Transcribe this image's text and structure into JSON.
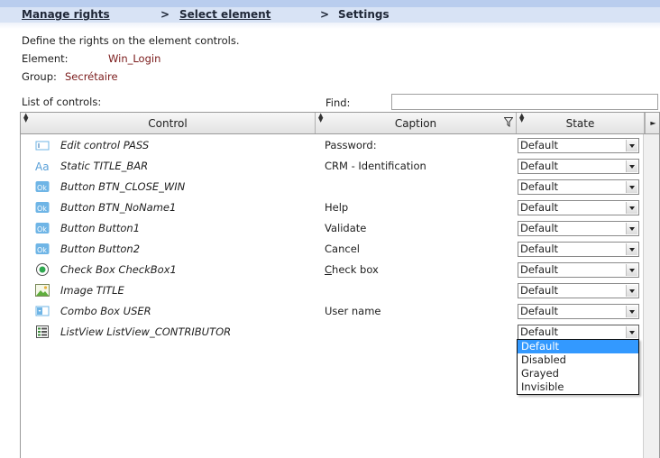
{
  "breadcrumb": {
    "step1": "Manage rights",
    "step2": "Select element",
    "step3": "Settings",
    "separator": ">"
  },
  "intro": {
    "description": "Define the rights on the element controls.",
    "element_label": "Element:",
    "element_value": "Win_Login",
    "group_label": "Group:",
    "group_value": "Secrétaire"
  },
  "list": {
    "label": "List of controls:",
    "find_label": "Find:",
    "find_value": ""
  },
  "table": {
    "columns": [
      "Control",
      "Caption",
      "State"
    ],
    "rows": [
      {
        "icon": "edit-control-icon",
        "control": "Edit control PASS",
        "caption": "Password:",
        "state": "Default"
      },
      {
        "icon": "static-text-icon",
        "control": "Static TITLE_BAR",
        "caption": "CRM - Identification",
        "state": "Default"
      },
      {
        "icon": "button-ok-icon",
        "control": "Button BTN_CLOSE_WIN",
        "caption": "",
        "state": "Default"
      },
      {
        "icon": "button-ok-icon",
        "control": "Button BTN_NoName1",
        "caption": "Help",
        "state": "Default"
      },
      {
        "icon": "button-ok-icon",
        "control": "Button Button1",
        "caption": "Validate",
        "state": "Default"
      },
      {
        "icon": "button-ok-icon",
        "control": "Button Button2",
        "caption": "Cancel",
        "state": "Default"
      },
      {
        "icon": "check-box-icon",
        "control": "Check Box CheckBox1",
        "caption_accel": "C",
        "caption": "heck box",
        "state": "Default"
      },
      {
        "icon": "image-icon",
        "control": "Image TITLE",
        "caption": "",
        "state": "Default"
      },
      {
        "icon": "combo-box-icon",
        "control": "Combo Box USER",
        "caption": "User name",
        "state": "Default"
      },
      {
        "icon": "listview-icon",
        "control": "ListView ListView_CONTRIBUTOR",
        "caption": "",
        "state": "Default"
      }
    ]
  },
  "dropdown": {
    "options": [
      "Default",
      "Disabled",
      "Grayed",
      "Invisible"
    ],
    "selected": "Default"
  },
  "colors": {
    "topbar": "#d8e3f5",
    "value_text": "#7a1a1a",
    "selection": "#3399ff",
    "icon_blue": "#6fb5e6"
  }
}
